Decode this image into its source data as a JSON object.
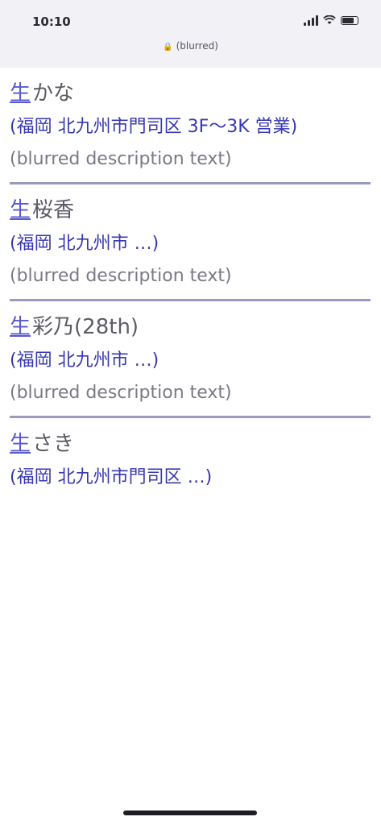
{
  "status": {
    "time": "10:10",
    "url": "(blurred)"
  },
  "entries": [
    {
      "link": "生",
      "title": "かな",
      "address": "(福岡 北九州市門司区 3F〜3K 営業)",
      "text": "(blurred description text)"
    },
    {
      "link": "生",
      "title": "桜香",
      "address": "(福岡 北九州市 …)",
      "text": "(blurred description text)"
    },
    {
      "link": "生",
      "title": "彩乃(28th)",
      "address": "(福岡 北九州市 …)",
      "text": "(blurred description text)"
    },
    {
      "link": "生",
      "title": "さき",
      "address": "(福岡 北九州市門司区 …)",
      "text": ""
    }
  ]
}
